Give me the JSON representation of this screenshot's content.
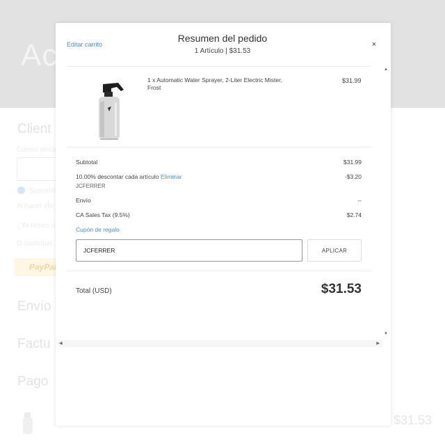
{
  "background": {
    "logo_text": "Ac",
    "sections": [
      "Client",
      "Envío",
      "Factu",
      "Pago"
    ],
    "small_texts": [
      "Correo electr",
      "Suscribirse",
      "Al hacer clic",
      "¿Ya tienes una",
      "O continuar"
    ],
    "paypal_label": "PayPal",
    "total": "$31.53"
  },
  "modal": {
    "edit_cart": "Editar carrito",
    "title": "Resumen del pedido",
    "subtitle": "1 Artículo | $31.53",
    "close": "×",
    "item": {
      "description": "1 x Automatic Water Sprayer, 2-Liter Electric Mister, Frost",
      "price": "$31.99"
    },
    "summary": {
      "subtotal_label": "Subtotal",
      "subtotal_value": "$31.99",
      "discount_label": "10.00% descontar cada artículo",
      "discount_remove": "Eliminar",
      "discount_code": "JCFERRER",
      "discount_value": "-$3.20",
      "shipping_label": "Envío",
      "shipping_value": "--",
      "tax_label": "CA Sales Tax (9.5%)",
      "tax_value": "$2.74"
    },
    "gift_coupon": "Cupón de regalo",
    "coupon_value": "JCFERRER",
    "apply_label": "APLICAR",
    "total_label": "Total (USD)",
    "total_value": "$31.53"
  }
}
